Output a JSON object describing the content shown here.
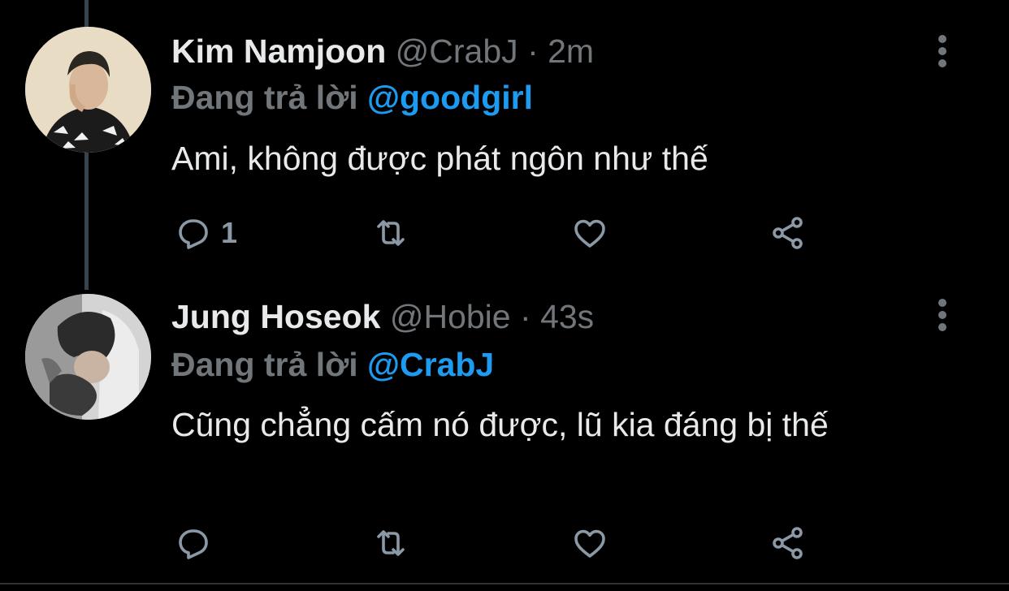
{
  "tweets": [
    {
      "name": "Kim Namjoon",
      "handle": "@CrabJ",
      "separator": "·",
      "time": "2m",
      "reply_prefix": "Đang trả lời",
      "reply_mention": "@goodgirl",
      "text": "Ami, không được phát ngôn như thế",
      "reply_count": "1",
      "avatar": "avatar-photo"
    },
    {
      "name": "Jung Hoseok",
      "handle": "@Hobie",
      "separator": "·",
      "time": "43s",
      "reply_prefix": "Đang trả lời",
      "reply_mention": "@CrabJ",
      "text": "Cũng chẳng cấm nó được, lũ kia đáng bị thế",
      "reply_count": "",
      "avatar": "avatar-photo"
    }
  ],
  "icons": {
    "reply": "reply-icon",
    "retweet": "retweet-icon",
    "like": "like-icon",
    "share": "share-icon",
    "more": "more-icon"
  },
  "colors": {
    "background": "#000000",
    "text": "#e7e9ea",
    "muted": "#71767b",
    "mention": "#1d9bf0",
    "thread_line": "#38444d"
  }
}
